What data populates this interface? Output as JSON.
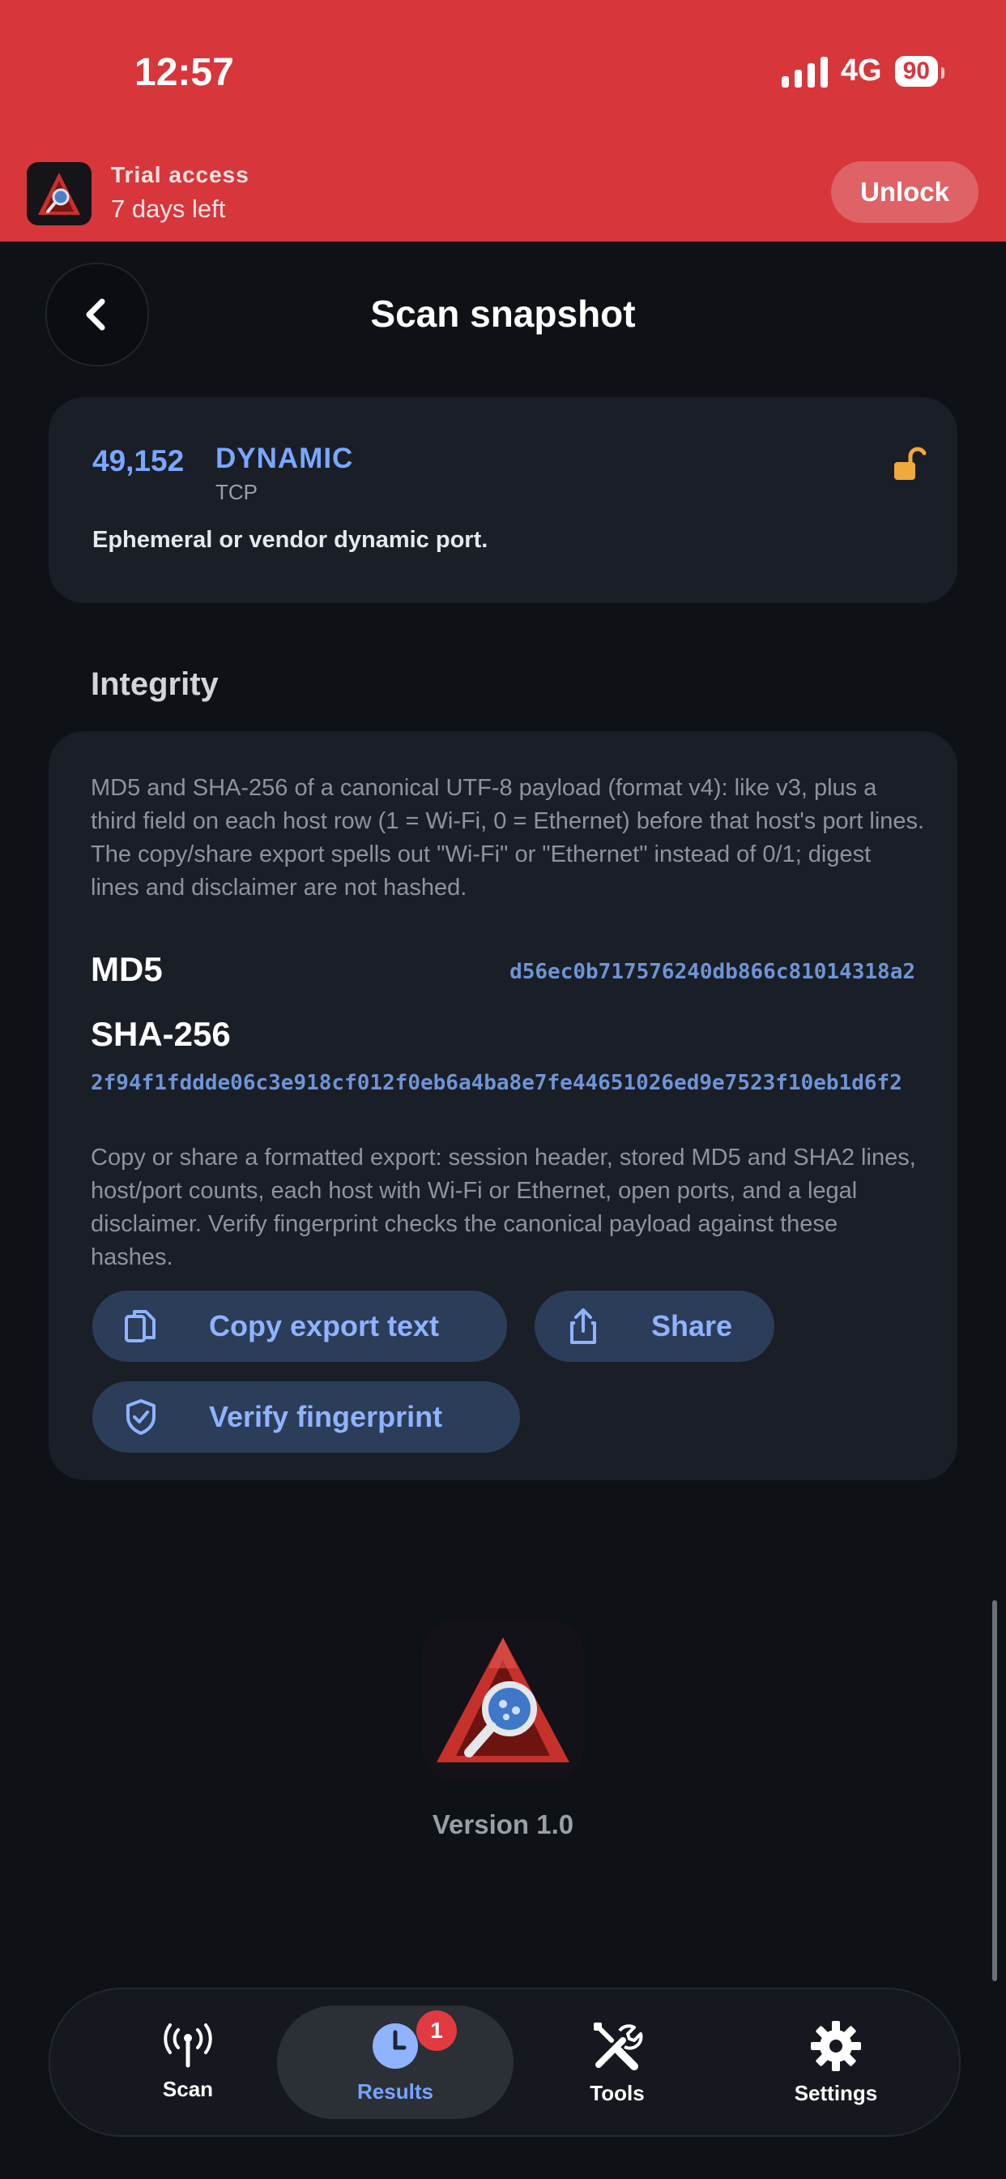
{
  "status_bar": {
    "time": "12:57",
    "network": "4G",
    "battery": "90"
  },
  "trial": {
    "title": "Trial access",
    "subtitle": "7 days left",
    "unlock_label": "Unlock"
  },
  "header": {
    "title": "Scan snapshot"
  },
  "port": {
    "number": "49,152",
    "name": "DYNAMIC",
    "protocol": "TCP",
    "description": "Ephemeral or vendor dynamic port."
  },
  "integrity": {
    "section_title": "Integrity",
    "description": "MD5 and SHA-256 of a canonical UTF-8 payload (format v4): like v3, plus a third field on each host row (1 = Wi-Fi, 0 = Ethernet) before that host's port lines. The copy/share export spells out \"Wi-Fi\" or \"Ethernet\" instead of 0/1; digest lines and disclaimer are not hashed.",
    "md5_label": "MD5",
    "md5_value": "d56ec0b717576240db866c81014318a2",
    "sha_label": "SHA-256",
    "sha_value": "2f94f1fddde06c3e918cf012f0eb6a4ba8e7fe44651026ed9e7523f10eb1d6f2",
    "export_description": "Copy or share a formatted export: session header, stored MD5 and SHA2 lines, host/port counts, each host with Wi-Fi or Ethernet, open ports, and a legal disclaimer. Verify fingerprint checks the canonical payload against these hashes.",
    "copy_label": "Copy export text",
    "share_label": "Share",
    "verify_label": "Verify fingerprint"
  },
  "footer": {
    "version": "Version 1.0"
  },
  "tabs": [
    {
      "label": "Scan",
      "icon": "antenna-icon"
    },
    {
      "label": "Results",
      "icon": "clock-icon",
      "badge": "1"
    },
    {
      "label": "Tools",
      "icon": "tools-icon"
    },
    {
      "label": "Settings",
      "icon": "gear-icon"
    }
  ],
  "colors": {
    "accent": "#7aa7ff",
    "banner": "#d7363b",
    "background": "#0e1116",
    "card": "#1a1e26"
  }
}
